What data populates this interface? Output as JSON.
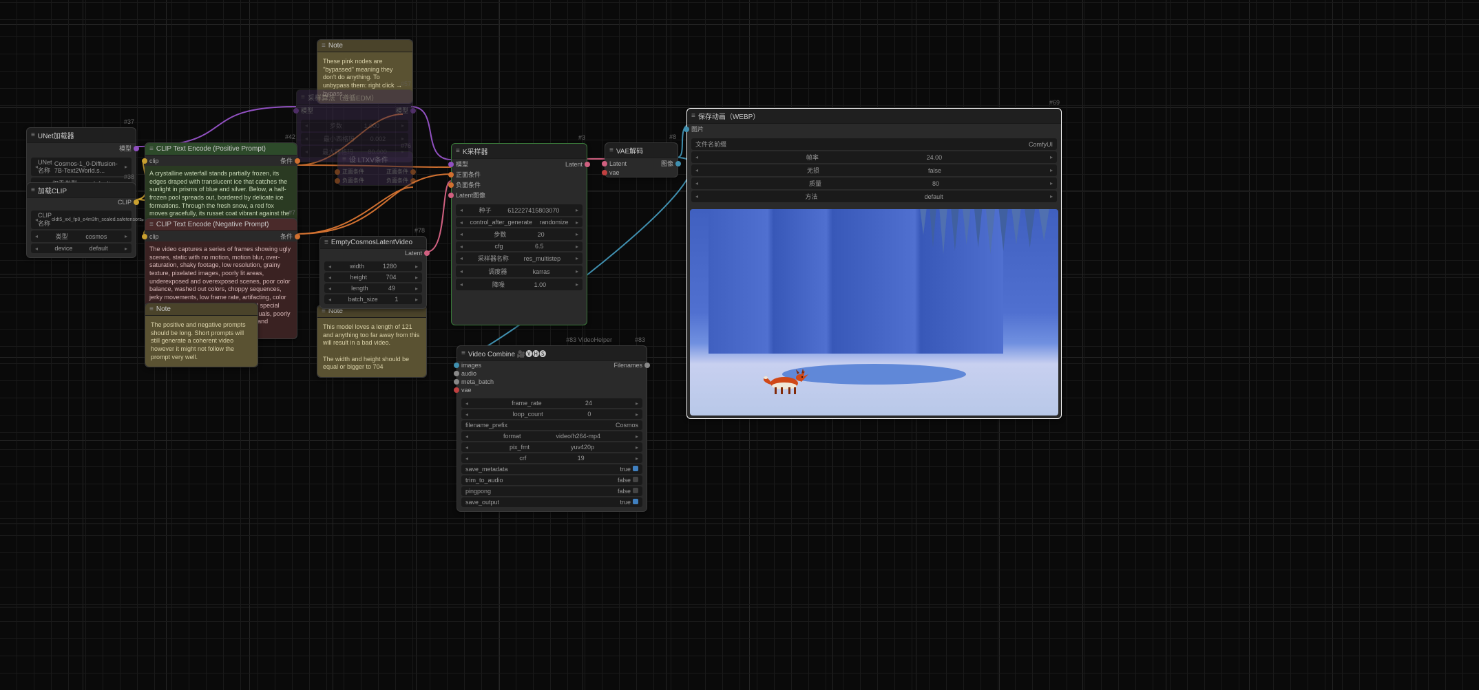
{
  "nodes": {
    "unet": {
      "id": "#37",
      "title": "UNet加载器",
      "out": "模型",
      "params": [
        {
          "k": "UNet名称",
          "v": "Cosmos-1_0-Diffusion-7B-Text2World.s..."
        },
        {
          "k": "权重类型",
          "v": "default"
        }
      ]
    },
    "clip_load": {
      "id": "#38",
      "title": "加载CLIP",
      "out": "CLIP",
      "params": [
        {
          "k": "CLIP名称",
          "v": "oldt5_xxl_fp8_e4m3fn_scaled.safetensors"
        },
        {
          "k": "类型",
          "v": "cosmos"
        },
        {
          "k": "device",
          "v": "default"
        }
      ]
    },
    "pos": {
      "id": "#42",
      "title": "CLIP Text Encode (Positive Prompt)",
      "in": "clip",
      "out": "条件",
      "text": "A crystalline waterfall stands partially frozen, its edges draped with translucent ice that catches the sunlight in prisms of blue and silver. Below, a half-frozen pool spreads out, bordered by delicate ice formations. Through the fresh snow, a red fox moves gracefully, its russet coat vibrant against the white landscape, leaving perfect star-shaped prints behind as steam rises from its breath in the crisp winter air. The scene is wrapped in snow-muffled silence, broken"
    },
    "neg": {
      "id": "#7",
      "title": "CLIP Text Encode (Negative Prompt)",
      "in": "clip",
      "out": "条件",
      "text": "The video captures a series of frames showing ugly scenes, static with no motion, motion blur, over-saturation, shaky footage, low resolution, grainy texture, pixelated images, poorly lit areas, underexposed and overexposed scenes, poor color balance, washed out colors, choppy sequences, jerky movements, low frame rate, artifacting, color banding, unnatural transitions, outdated special effects, fake elements, unconvincing visuals, poorly edited content, jump cuts, visual noise, and flickering. Overall, the video is"
    },
    "empty": {
      "id": "#78",
      "title": "EmptyCosmosLatentVideo",
      "out": "Latent",
      "params": [
        {
          "k": "width",
          "v": "1280"
        },
        {
          "k": "height",
          "v": "704"
        },
        {
          "k": "length",
          "v": "49"
        },
        {
          "k": "batch_size",
          "v": "1"
        }
      ]
    },
    "ksampler": {
      "id": "#3",
      "title": "K采样器",
      "ins": [
        "模型",
        "正面条件",
        "负面条件",
        "Latent图像"
      ],
      "out": "Latent",
      "params": [
        {
          "k": "种子",
          "v": "612227415803070"
        },
        {
          "k": "control_after_generate",
          "v": "randomize"
        },
        {
          "k": "步数",
          "v": "20"
        },
        {
          "k": "cfg",
          "v": "6.5"
        },
        {
          "k": "采样器名称",
          "v": "res_multistep"
        },
        {
          "k": "调度器",
          "v": "karras"
        },
        {
          "k": "降噪",
          "v": "1.00"
        }
      ]
    },
    "vae": {
      "id": "#8",
      "title": "VAE解码",
      "ins": [
        "Latent",
        "vae"
      ],
      "out": "图像"
    },
    "save_webp": {
      "id": "#69",
      "title": "保存动画（WEBP）",
      "in": "图片",
      "params": [
        {
          "k": "文件名前缀",
          "v": "ComfyUI"
        },
        {
          "k": "帧率",
          "v": "24.00"
        },
        {
          "k": "无损",
          "v": "false"
        },
        {
          "k": "质量",
          "v": "80"
        },
        {
          "k": "方法",
          "v": "default"
        }
      ]
    },
    "video_combine": {
      "id": "#83",
      "id_left": "#83 VideoHelper",
      "title": "Video Combine 🎥🅥🅗🅢",
      "ins": [
        "images",
        "audio",
        "meta_batch",
        "vae"
      ],
      "out": "Filenames",
      "params": [
        {
          "k": "frame_rate",
          "v": "24"
        },
        {
          "k": "loop_count",
          "v": "0"
        },
        {
          "k": "filename_prefix",
          "v": "Cosmos"
        },
        {
          "k": "format",
          "v": "video/h264-mp4"
        },
        {
          "k": "pix_fmt",
          "v": "yuv420p"
        },
        {
          "k": "crf",
          "v": "19"
        },
        {
          "k": "save_metadata",
          "v": "true"
        },
        {
          "k": "trim_to_audio",
          "v": "false"
        },
        {
          "k": "pingpong",
          "v": "false"
        },
        {
          "k": "save_output",
          "v": "true"
        }
      ]
    },
    "note1": {
      "title": "Note",
      "text": "These pink nodes are \"bypassed\" meaning they don't do anything. To unbypass them: right click → bypass"
    },
    "note2": {
      "title": "Note",
      "text": "The positive and negative prompts should be long. Short prompts will still generate a coherent video however it might not follow the prompt very well."
    },
    "note3": {
      "title": "Note",
      "text": "This model loves a length of 121 and anything too far away from this will result in a bad video.\n\nThe width and height should be equal or bigger to 704"
    },
    "bypassed1": {
      "id": "#57",
      "title": "采样算法（遵循EDM）",
      "ins": [
        "模型"
      ],
      "outs": [
        "模型"
      ],
      "params": [
        {
          "k": "步数",
          "v": "1.000"
        },
        {
          "k": "最小西格玛",
          "v": "0.002"
        },
        {
          "k": "最大西格玛",
          "v": "80.000"
        }
      ]
    },
    "bypassed2": {
      "id": "#76",
      "title": "设 LTXV条件",
      "ins": [
        "正面条件",
        "负面条件"
      ],
      "outs": [
        "正面条件",
        "负面条件"
      ],
      "params": []
    }
  }
}
